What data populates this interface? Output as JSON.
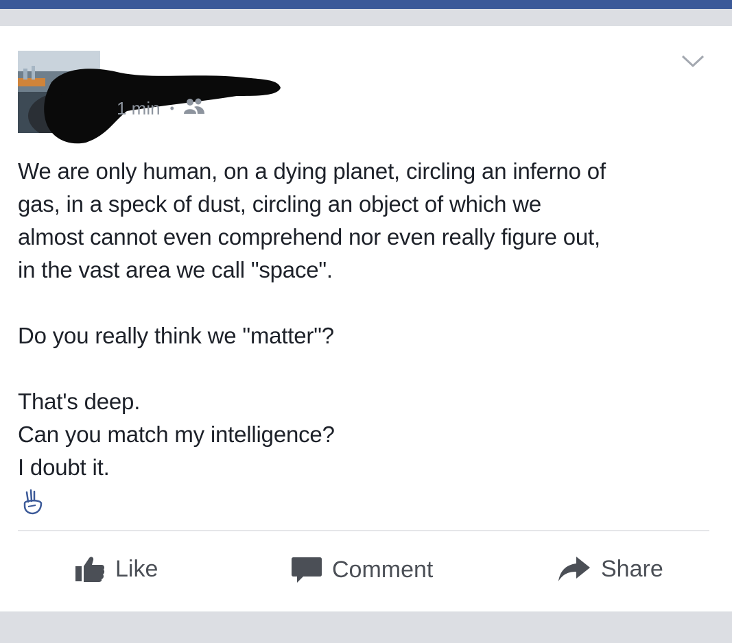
{
  "post": {
    "timestamp": "1 min",
    "separator": "•",
    "audience_icon": "friends-icon",
    "body": "We are only human, on a dying planet, circling an inferno of\ngas, in a speck of dust, circling an object of which we\nalmost cannot even comprehend nor even really figure out,\nin the vast area we call \"space\".\n\nDo you really think we \"matter\"?\n\nThat's deep.\nCan you match my intelligence?\nI doubt it.",
    "emoji_icon": "peace-hand-icon",
    "menu_icon": "chevron-down-icon"
  },
  "actions": {
    "like": {
      "label": "Like",
      "icon": "thumbs-up-icon"
    },
    "comment": {
      "label": "Comment",
      "icon": "speech-bubble-icon"
    },
    "share": {
      "label": "Share",
      "icon": "share-arrow-icon"
    }
  },
  "colors": {
    "brand": "#3b5998",
    "text": "#1d2129",
    "muted": "#8d949e",
    "action": "#4b4f56"
  }
}
